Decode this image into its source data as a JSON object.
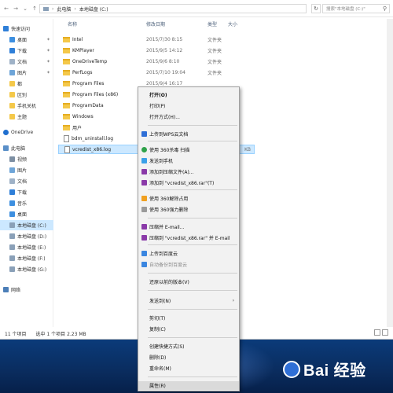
{
  "address": {
    "crumbs": [
      "此电脑",
      "本地磁盘 (C:)"
    ],
    "search_placeholder": "搜索\"本地磁盘 (C:)\""
  },
  "columns": {
    "name": "名称",
    "date": "修改日期",
    "type": "类型",
    "size": "大小"
  },
  "sidebar": {
    "items": [
      {
        "label": "快速访问",
        "pinned": false
      },
      {
        "label": "桌面",
        "pinned": true
      },
      {
        "label": "下载",
        "pinned": true
      },
      {
        "label": "文档",
        "pinned": true
      },
      {
        "label": "图片",
        "pinned": true
      },
      {
        "label": "都",
        "pinned": false
      },
      {
        "label": "区别",
        "pinned": false
      },
      {
        "label": "手机关机",
        "pinned": false
      },
      {
        "label": "主题",
        "pinned": false
      },
      {
        "label": "OneDrive",
        "pinned": false
      },
      {
        "label": "此电脑",
        "pinned": false
      },
      {
        "label": "视频",
        "pinned": false
      },
      {
        "label": "图片",
        "pinned": false
      },
      {
        "label": "文档",
        "pinned": false
      },
      {
        "label": "下载",
        "pinned": false
      },
      {
        "label": "音乐",
        "pinned": false
      },
      {
        "label": "桌面",
        "pinned": false
      },
      {
        "label": "本地磁盘 (C:)",
        "pinned": false
      },
      {
        "label": "本地磁盘 (D:)",
        "pinned": false
      },
      {
        "label": "本地磁盘 (E:)",
        "pinned": false
      },
      {
        "label": "本地磁盘 (F:)",
        "pinned": false
      },
      {
        "label": "本地磁盘 (G:)",
        "pinned": false
      },
      {
        "label": "网络",
        "pinned": false
      }
    ]
  },
  "files": [
    {
      "name": "Intel",
      "date": "2015/7/30 8:15",
      "type": "文件夹",
      "size": ""
    },
    {
      "name": "KMPlayer",
      "date": "2015/9/5 14:12",
      "type": "文件夹",
      "size": ""
    },
    {
      "name": "OneDriveTemp",
      "date": "2015/9/6 8:10",
      "type": "文件夹",
      "size": ""
    },
    {
      "name": "PerfLogs",
      "date": "2015/7/10 19:04",
      "type": "文件夹",
      "size": ""
    },
    {
      "name": "Program Files",
      "date": "2015/9/4 16:17",
      "type": "文件夹",
      "size": ""
    },
    {
      "name": "Program Files (x86)",
      "date": "",
      "type": "",
      "size": ""
    },
    {
      "name": "ProgramData",
      "date": "",
      "type": "",
      "size": ""
    },
    {
      "name": "Windows",
      "date": "",
      "type": "",
      "size": ""
    },
    {
      "name": "用户",
      "date": "",
      "type": "",
      "size": ""
    },
    {
      "name": "bdm_uninstall.log",
      "date": "",
      "type": "",
      "size": ""
    },
    {
      "name": "vcredist_x86.log",
      "date": "",
      "type": "",
      "size": "KB"
    }
  ],
  "status": {
    "count": "11 个项目",
    "selected": "选中 1 个项目  2.23 MB"
  },
  "context_menu": {
    "items": [
      {
        "label": "打开(O)",
        "bold": true
      },
      {
        "label": "打印(P)"
      },
      {
        "label": "打开方式(H)..."
      },
      {
        "label": "上传到WPS云文档"
      },
      {
        "label": "使用 360杀毒 扫描"
      },
      {
        "label": "发送到手机"
      },
      {
        "label": "添加到压缩文件(A)..."
      },
      {
        "label": "添加到 \"vcredist_x86.rar\"(T)"
      },
      {
        "label": "使用 360解除占用"
      },
      {
        "label": "使用 360强力删除"
      },
      {
        "label": "压缩并 E-mail..."
      },
      {
        "label": "压缩到 \"vcredist_x86.rar\" 并 E-mail"
      },
      {
        "label": "上传到百度云"
      },
      {
        "label": "自动备份到百度云"
      },
      {
        "label": "还原以前的版本(V)"
      },
      {
        "label": "发送到(N)",
        "submenu": true
      },
      {
        "label": "剪切(T)"
      },
      {
        "label": "复制(C)"
      },
      {
        "label": "创建快捷方式(S)"
      },
      {
        "label": "删除(D)"
      },
      {
        "label": "重命名(M)"
      },
      {
        "label": "属性(R)"
      }
    ],
    "submenu_arrow": "›"
  },
  "watermark": {
    "text": "Bai 经验"
  },
  "colors": {
    "selection": "#cce8ff",
    "folder": "#f4c84a",
    "desktop": "#0b3b7a"
  }
}
